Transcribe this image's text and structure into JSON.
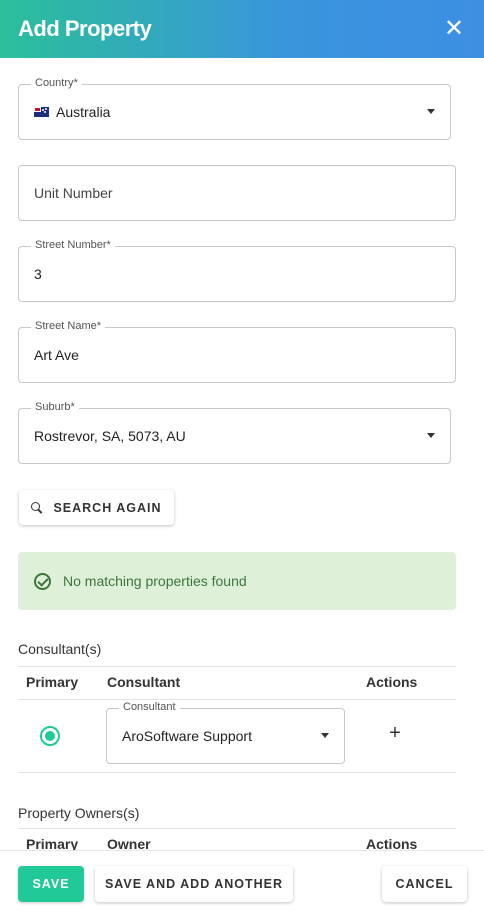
{
  "header": {
    "title": "Add Property",
    "close_icon": "close-icon"
  },
  "form": {
    "country": {
      "label": "Country*",
      "value": "Australia",
      "flag_icon": "australia-flag-icon"
    },
    "unit_number": {
      "placeholder": "Unit Number",
      "value": ""
    },
    "street_number": {
      "label": "Street Number*",
      "value": "3"
    },
    "street_name": {
      "label": "Street Name*",
      "value": "Art Ave"
    },
    "suburb": {
      "label": "Suburb*",
      "value": "Rostrevor, SA, 5073, AU"
    }
  },
  "search_again": {
    "label": "SEARCH AGAIN",
    "icon": "search-icon"
  },
  "alert": {
    "text": "No matching properties found",
    "icon": "check-circle-icon",
    "color": "#3c763d",
    "background": "#dff0d8"
  },
  "consultants": {
    "title": "Consultant(s)",
    "columns": [
      "Primary",
      "Consultant",
      "Actions"
    ],
    "rows": [
      {
        "primary": true,
        "consultant_label": "Consultant",
        "consultant_value": "AroSoftware Support",
        "action": "+"
      }
    ]
  },
  "owners": {
    "title": "Property Owners(s)",
    "columns": [
      "Primary",
      "Owner",
      "Actions"
    ]
  },
  "footer": {
    "save": "SAVE",
    "save_and_add": "SAVE AND ADD ANOTHER",
    "cancel": "CANCEL"
  },
  "colors": {
    "accent": "#20c997",
    "header_gradient_start": "#2bbf9a",
    "header_gradient_end": "#3d8fe3"
  }
}
